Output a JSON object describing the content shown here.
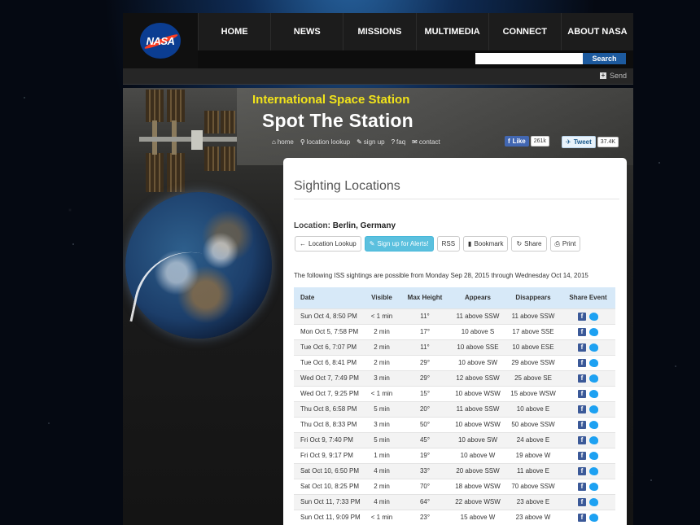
{
  "nav": {
    "items": [
      "HOME",
      "NEWS",
      "MISSIONS",
      "MULTIMEDIA",
      "CONNECT",
      "ABOUT NASA"
    ],
    "logo_text": "NASA",
    "search_button": "Search",
    "search_placeholder": "",
    "send_label": "Send"
  },
  "hero": {
    "subtitle": "International Space Station",
    "title": "Spot The Station",
    "links": [
      {
        "icon": "home-icon",
        "label": "home"
      },
      {
        "icon": "pin-icon",
        "label": "location lookup"
      },
      {
        "icon": "pencil-icon",
        "label": "sign up"
      },
      {
        "icon": "question-icon",
        "label": "faq"
      },
      {
        "icon": "envelope-icon",
        "label": "contact"
      }
    ],
    "like_label": "Like",
    "like_count": "261k",
    "tweet_label": "Tweet",
    "tweet_count": "37.4K"
  },
  "content": {
    "title": "Sighting Locations",
    "location_label": "Location:",
    "location_value": "Berlin, Germany",
    "buttons": [
      "Location Lookup",
      "Sign up for Alerts!",
      "RSS",
      "Bookmark",
      "Share",
      "Print"
    ],
    "intro": "The following ISS sightings are possible from Monday Sep 28, 2015 through Wednesday Oct 14, 2015"
  },
  "table": {
    "headers": [
      "Date",
      "Visible",
      "Max Height",
      "Appears",
      "Disappears",
      "Share Event"
    ],
    "rows": [
      [
        "Sun Oct 4, 8:50 PM",
        "< 1 min",
        "11°",
        "11 above SSW",
        "11 above SSW"
      ],
      [
        "Mon Oct 5, 7:58 PM",
        "2 min",
        "17°",
        "10 above S",
        "17 above SSE"
      ],
      [
        "Tue Oct 6, 7:07 PM",
        "2 min",
        "11°",
        "10 above SSE",
        "10 above ESE"
      ],
      [
        "Tue Oct 6, 8:41 PM",
        "2 min",
        "29°",
        "10 above SW",
        "29 above SSW"
      ],
      [
        "Wed Oct 7, 7:49 PM",
        "3 min",
        "29°",
        "12 above SSW",
        "25 above SE"
      ],
      [
        "Wed Oct 7, 9:25 PM",
        "< 1 min",
        "15°",
        "10 above WSW",
        "15 above WSW"
      ],
      [
        "Thu Oct 8, 6:58 PM",
        "5 min",
        "20°",
        "11 above SSW",
        "10 above E"
      ],
      [
        "Thu Oct 8, 8:33 PM",
        "3 min",
        "50°",
        "10 above WSW",
        "50 above SSW"
      ],
      [
        "Fri Oct 9, 7:40 PM",
        "5 min",
        "45°",
        "10 above SW",
        "24 above E"
      ],
      [
        "Fri Oct 9, 9:17 PM",
        "1 min",
        "19°",
        "10 above W",
        "19 above W"
      ],
      [
        "Sat Oct 10, 6:50 PM",
        "4 min",
        "33°",
        "20 above SSW",
        "11 above E"
      ],
      [
        "Sat Oct 10, 8:25 PM",
        "2 min",
        "70°",
        "18 above WSW",
        "70 above SSW"
      ],
      [
        "Sun Oct 11, 7:33 PM",
        "4 min",
        "64°",
        "22 above WSW",
        "23 above E"
      ],
      [
        "Sun Oct 11, 9:09 PM",
        "< 1 min",
        "23°",
        "15 above W",
        "23 above W"
      ]
    ]
  },
  "colors": {
    "nav_bg": "#1c1c1c",
    "search_button": "#1d5a9e",
    "subtitle": "#f2e41a",
    "table_header": "#d7e9f8",
    "primary_button": "#5bc0de"
  }
}
